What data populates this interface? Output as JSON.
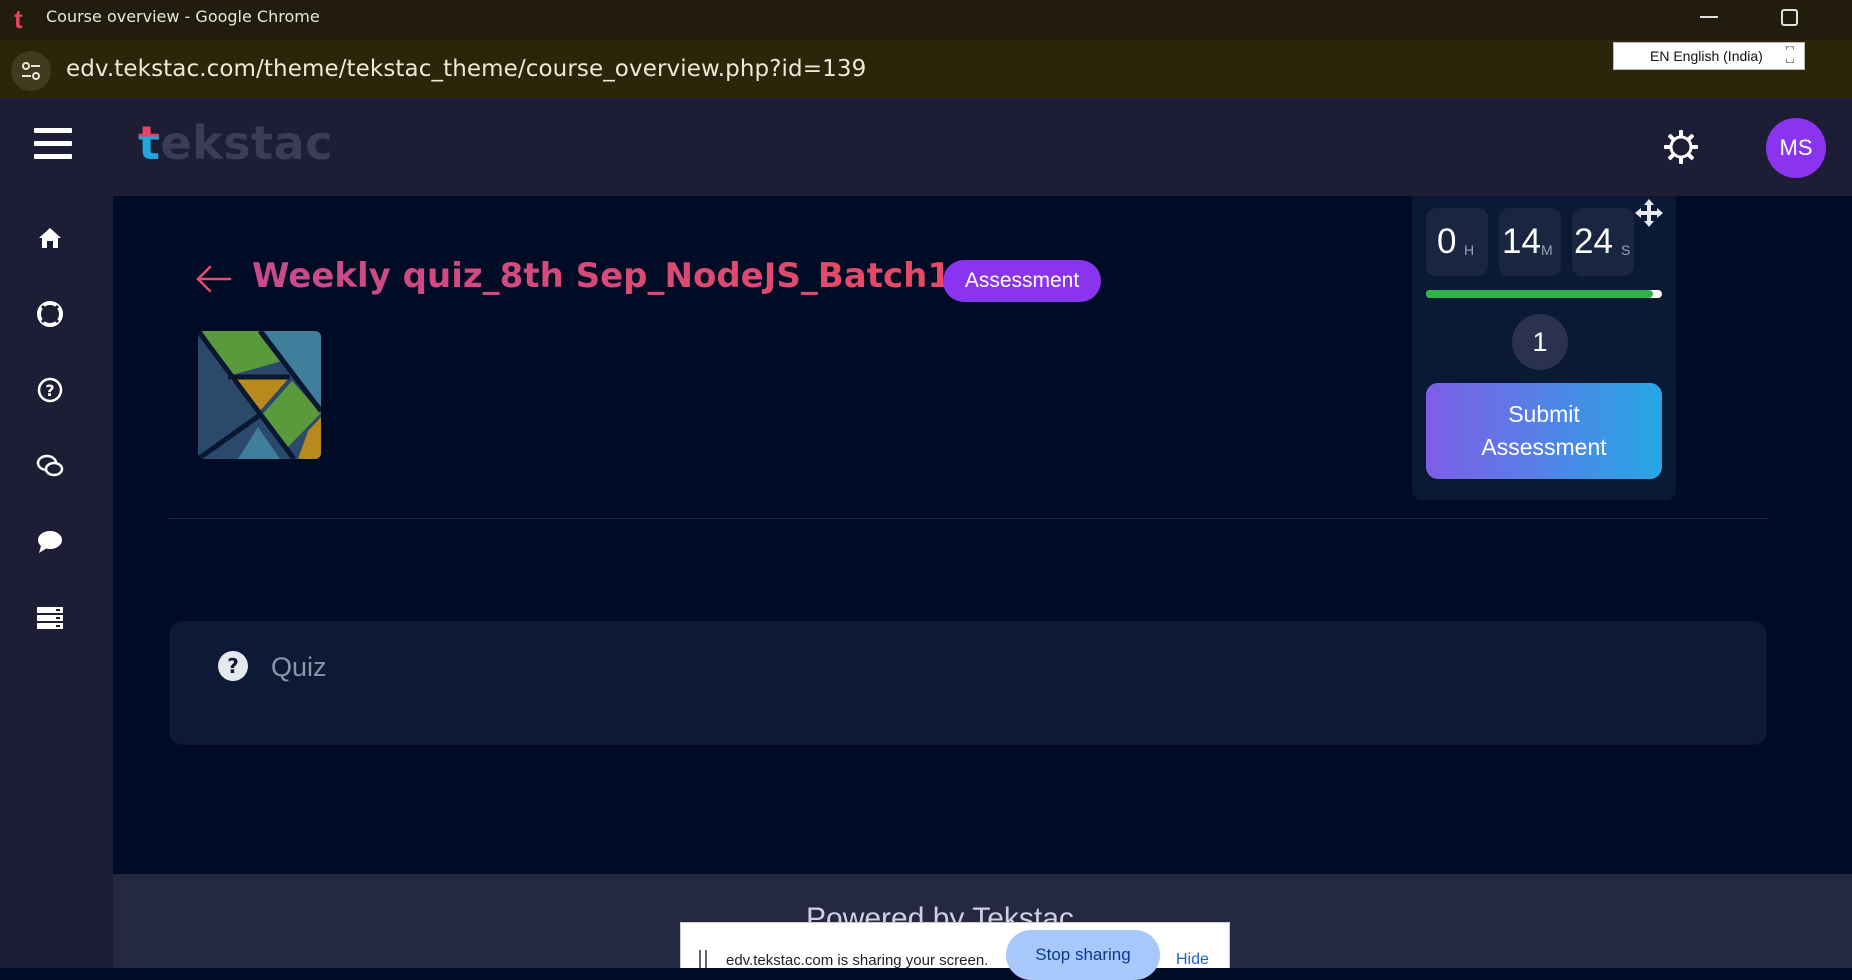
{
  "browser": {
    "window_title": "Course overview - Google Chrome",
    "url": "edv.tekstac.com/theme/tekstac_theme/course_overview.php?id=139",
    "language_indicator": "EN English (India)"
  },
  "header": {
    "logo_t": "t",
    "logo_rest": "ekstac",
    "avatar_initials": "MS"
  },
  "sidebar": {
    "items": [
      {
        "icon": "home-icon"
      },
      {
        "icon": "lifebuoy-icon"
      },
      {
        "icon": "help-circle-icon"
      },
      {
        "icon": "chat-bubbles-icon"
      },
      {
        "icon": "speech-bubble-icon"
      },
      {
        "icon": "server-list-icon"
      }
    ]
  },
  "course": {
    "title": "Weekly quiz_8th Sep_NodeJS_Batch1",
    "badge": "Assessment"
  },
  "sections": [
    {
      "label": "Quiz",
      "icon": "help-circle-icon"
    }
  ],
  "timer": {
    "hours": "0",
    "hours_unit": "H",
    "minutes": "14",
    "minutes_unit": "M",
    "seconds": "24",
    "seconds_unit": "S",
    "progress_fraction": 0.96,
    "question_number": "1",
    "submit_label": "Submit Assessment"
  },
  "footer": {
    "powered_by": "Powered by Tekstac"
  },
  "sharing_bar": {
    "message": "edv.tekstac.com is sharing your screen.",
    "stop_label": "Stop sharing",
    "hide_label": "Hide"
  },
  "colors": {
    "accent_purple": "#8a34f0",
    "title_pink": "#e34d6f",
    "progress_green": "#2fb24a",
    "page_bg": "#000b25",
    "header_bg": "#1d1e36"
  }
}
